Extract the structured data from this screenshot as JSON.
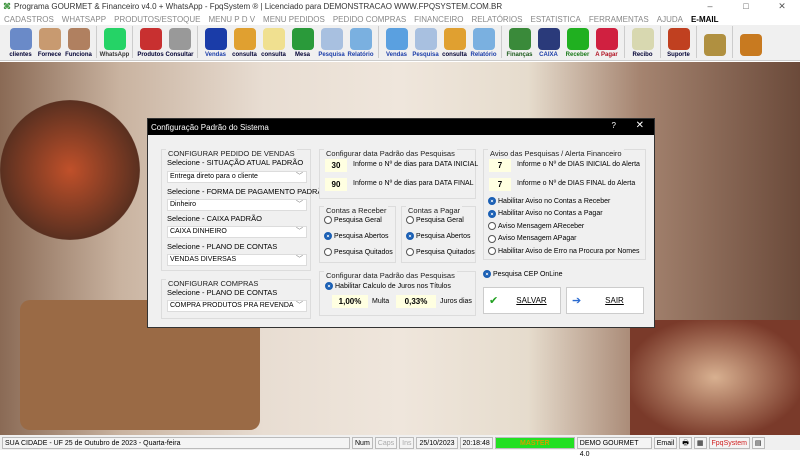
{
  "window": {
    "title": "Programa GOURMET & Financeiro v4.0 + WhatsApp - FpqSystem ® | Licenciado para  DEMONSTRACAO WWW.FPQSYSTEM.COM.BR",
    "minimize": "–",
    "maximize": "□",
    "close": "✕"
  },
  "menu": [
    "CADASTROS",
    "WHATSAPP",
    "PRODUTOS/ESTOQUE",
    "MENU P D V",
    "MENU PEDIDOS",
    "PEDIDO COMPRAS",
    "FINANCEIRO",
    "RELATÓRIOS",
    "ESTATISTICA",
    "FERRAMENTAS",
    "AJUDA"
  ],
  "menu_email": "E-MAIL",
  "toolbar": [
    {
      "label": "clientes",
      "color": "#6a8ac8",
      "text": "#003"
    },
    {
      "label": "Fornece",
      "color": "#c89a70",
      "text": "#003"
    },
    {
      "label": "Funciona",
      "color": "#b08060",
      "text": "#003"
    },
    {
      "sep": true
    },
    {
      "label": "WhatsApp",
      "color": "#25d366",
      "text": "#333"
    },
    {
      "sep": true
    },
    {
      "label": "Produtos",
      "color": "#c83030",
      "text": "#003"
    },
    {
      "label": "Consultar",
      "color": "#999",
      "text": "#003"
    },
    {
      "sep": true
    },
    {
      "label": "Vendas",
      "color": "#1a3ca8",
      "text": "#1a3ca8"
    },
    {
      "label": "consulta",
      "color": "#e0a030",
      "text": "#003"
    },
    {
      "label": "consulta",
      "color": "#f0e090",
      "text": "#003"
    },
    {
      "label": "Mesa",
      "color": "#2a9a3a",
      "text": "#003"
    },
    {
      "label": "Pesquisa",
      "color": "#a8c0e0",
      "text": "#1a3ca8"
    },
    {
      "label": "Relatório",
      "color": "#7ab0e0",
      "text": "#1a3ca8"
    },
    {
      "sep": true
    },
    {
      "label": "Vendas",
      "color": "#5aa0e0",
      "text": "#1a3ca8"
    },
    {
      "label": "Pesquisa",
      "color": "#a8c0e0",
      "text": "#1a3ca8"
    },
    {
      "label": "consulta",
      "color": "#e0a030",
      "text": "#003"
    },
    {
      "label": "Relatório",
      "color": "#7ab0e0",
      "text": "#1a3ca8"
    },
    {
      "sep": true
    },
    {
      "label": "Finanças",
      "color": "#3a8a3a",
      "text": "#1a5a1a"
    },
    {
      "label": "CAIXA",
      "color": "#2a3a7a",
      "text": "#1a3ca8"
    },
    {
      "label": "Receber",
      "color": "#20b020",
      "text": "#1a7a1a"
    },
    {
      "label": "A Pagar",
      "color": "#d02040",
      "text": "#b01020"
    },
    {
      "sep": true
    },
    {
      "label": "Recibo",
      "color": "#d8d8b0",
      "text": "#003"
    },
    {
      "sep": true
    },
    {
      "label": "Suporte",
      "color": "#c04020",
      "text": "#003"
    },
    {
      "sep": true
    },
    {
      "label": "",
      "color": "#b09040",
      "text": "#003"
    },
    {
      "sep": true
    },
    {
      "label": "",
      "color": "#c87a20",
      "text": "#003"
    }
  ],
  "dialog": {
    "title": "Configuração Padrão do Sistema",
    "help": "?",
    "close": "✕",
    "vendas": {
      "legend": "CONFIGURAR PEDIDO DE VENDAS",
      "situacao_label": "Selecione - SITUAÇÃO ATUAL PADRÃO",
      "situacao_value": "Entrega direto para o cliente",
      "pagamento_label": "Selecione - FORMA DE PAGAMENTO PADRÃO",
      "pagamento_value": "Dinheiro",
      "caixa_label": "Selecione - CAIXA PADRÃO",
      "caixa_value": "CAIXA DINHEIRO",
      "plano_label": "Selecione - PLANO DE CONTAS",
      "plano_value": "VENDAS DIVERSAS"
    },
    "compras": {
      "legend": "CONFIGURAR COMPRAS",
      "plano_label": "Selecione - PLANO DE CONTAS",
      "plano_value": "COMPRA PRODUTOS PRA REVENDA"
    },
    "datas": {
      "legend": "Configurar data Padrão das Pesquisas",
      "inicial": "30",
      "inicial_label": "Informe o Nº de dias para DATA INICIAL",
      "final": "90",
      "final_label": "Informe o Nº de dias para DATA FINAL"
    },
    "receber": {
      "legend": "Contas a Receber",
      "options": [
        "Pesquisa Geral",
        "Pesquisa Abertos",
        "Pesquisa Quitados"
      ],
      "selected": 1
    },
    "pagar": {
      "legend": "Contas a Pagar",
      "options": [
        "Pesquisa Geral",
        "Pesquisa Abertos",
        "Pesquisa Quitados"
      ],
      "selected": 1
    },
    "juros": {
      "legend": "Configurar data Padrão das Pesquisas",
      "habilitar": "Habilitar Calculo de Juros nos Títulos",
      "multa": "1,00%",
      "multa_label": "Multa",
      "juros": "0,33%",
      "juros_label": "Juros dias"
    },
    "aviso": {
      "legend": "Aviso das Pesquisas / Alerta Financeiro",
      "inicial": "7",
      "inicial_label": "Informe o Nº de DIAS INICIAL do Alerta",
      "final": "7",
      "final_label": "Informe o Nº de DIAS FINAL do Alerta",
      "options": [
        {
          "label": "Habilitar Aviso no Contas a Receber",
          "on": true
        },
        {
          "label": "Habilitar Aviso no Contas a Pagar",
          "on": true
        },
        {
          "label": "Aviso Mensagem AReceber",
          "on": false
        },
        {
          "label": "Aviso Mensagem APagar",
          "on": false
        },
        {
          "label": "Habilitar Aviso de Erro na Procura por Nomes",
          "on": false
        }
      ]
    },
    "cep": "Pesquisa CEP OnLine",
    "salvar": "SALVAR",
    "sair": "SAIR"
  },
  "status": {
    "cidade": "SUA CIDADE - UF 25 de Outubro de 2023 - Quarta-feira",
    "num": "Num",
    "caps": "Caps",
    "ins": "Ins",
    "date": "25/10/2023",
    "time": "20:18:48",
    "user": "MASTER",
    "empresa": "DEMO GOURMET 4.0",
    "email": "Email",
    "brand": "FpqSystem",
    "user_color": "#22e022",
    "brand_color": "#d02020"
  }
}
